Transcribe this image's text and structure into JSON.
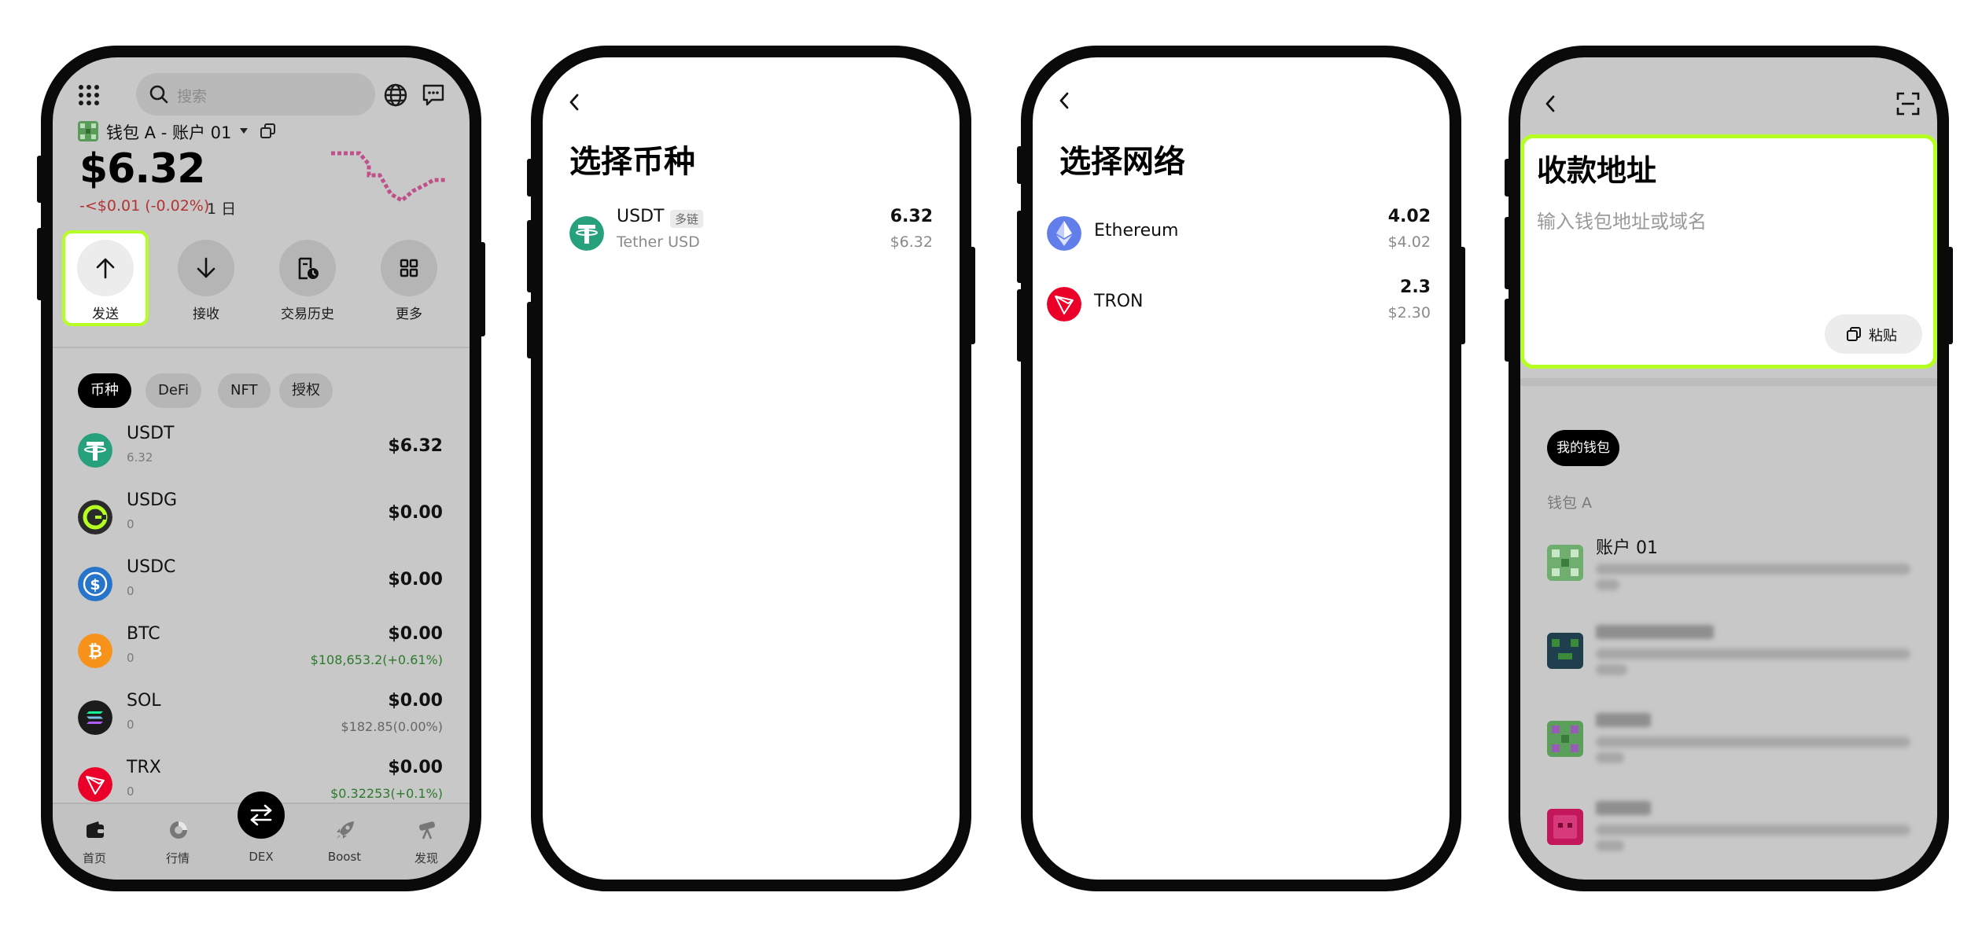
{
  "screen1": {
    "search": {
      "placeholder": "搜索"
    },
    "wallet_label": "钱包 A - 账户 01",
    "balance": "$6.32",
    "change": "-<$0.01 (-0.02%)",
    "period": "1 日",
    "actions": [
      {
        "label": "发送",
        "icon": "arrow-up-icon"
      },
      {
        "label": "接收",
        "icon": "arrow-down-icon"
      },
      {
        "label": "交易历史",
        "icon": "history-icon"
      },
      {
        "label": "更多",
        "icon": "grid-icon"
      }
    ],
    "filters": [
      "币种",
      "DeFi",
      "NFT",
      "授权"
    ],
    "coins": [
      {
        "symbol": "USDT",
        "qty": "6.32",
        "value": "$6.32",
        "price": "",
        "color": "#26a17b"
      },
      {
        "symbol": "USDG",
        "qty": "0",
        "value": "$0.00",
        "price": "",
        "color": "#2b2b2b"
      },
      {
        "symbol": "USDC",
        "qty": "0",
        "value": "$0.00",
        "price": "",
        "color": "#2775ca"
      },
      {
        "symbol": "BTC",
        "qty": "0",
        "value": "$0.00",
        "price": "$108,653.2(+0.61%)",
        "color": "#f7931a"
      },
      {
        "symbol": "SOL",
        "qty": "0",
        "value": "$0.00",
        "price": "$182.85(0.00%)",
        "color": "#1b1b1b"
      },
      {
        "symbol": "TRX",
        "qty": "0",
        "value": "$0.00",
        "price": "$0.32253(+0.1%)",
        "color": "#eb0029"
      }
    ],
    "tabs": [
      {
        "label": "首页",
        "icon": "wallet-icon"
      },
      {
        "label": "行情",
        "icon": "market-icon"
      },
      {
        "label": "DEX",
        "icon": "swap-icon"
      },
      {
        "label": "Boost",
        "icon": "rocket-icon"
      },
      {
        "label": "发现",
        "icon": "telescope-icon"
      }
    ],
    "colors": {
      "accent": "#b5ff22",
      "negative": "#b23434",
      "positive": "#2c7a2c",
      "sparkline": "#c0508a"
    }
  },
  "screen2": {
    "title": "选择币种",
    "items": [
      {
        "symbol": "USDT",
        "tag": "多链",
        "name": "Tether USD",
        "amount": "6.32",
        "usd": "$6.32"
      }
    ]
  },
  "screen3": {
    "title": "选择网络",
    "networks": [
      {
        "name": "Ethereum",
        "amount": "4.02",
        "usd": "$4.02",
        "color": "#627eea"
      },
      {
        "name": "TRON",
        "amount": "2.3",
        "usd": "$2.30",
        "color": "#eb0029"
      }
    ]
  },
  "screen4": {
    "title": "收款地址",
    "placeholder": "输入钱包地址或域名",
    "paste": "粘贴",
    "wallet_chip": "我的钱包",
    "group": "钱包 A",
    "accounts": [
      {
        "name": "账户 01"
      }
    ]
  }
}
